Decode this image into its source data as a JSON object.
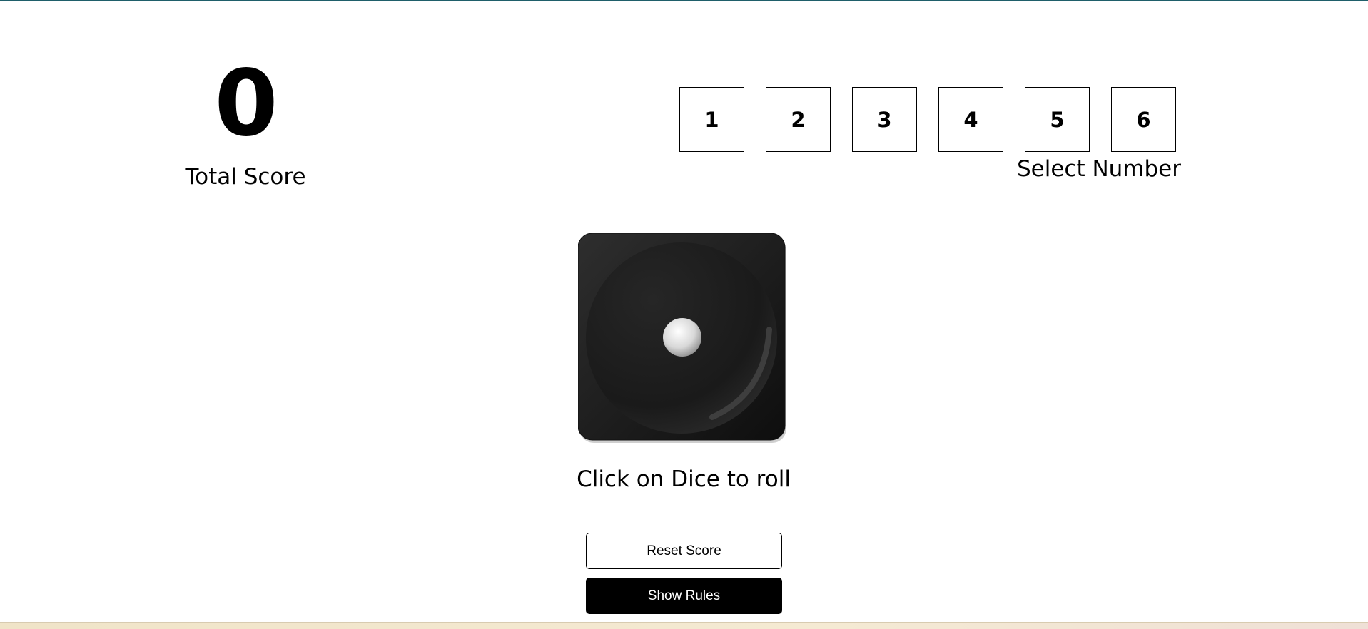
{
  "score": {
    "value": "0",
    "label": "Total Score"
  },
  "number_select": {
    "numbers": [
      "1",
      "2",
      "3",
      "4",
      "5",
      "6"
    ],
    "label": "Select Number"
  },
  "dice": {
    "face": 1,
    "icon": "dice-one-icon",
    "caption": "Click on Dice to roll"
  },
  "buttons": {
    "reset_label": "Reset Score",
    "rules_label": "Show Rules"
  },
  "colors": {
    "accent_line": "#1f5f6a",
    "dice_body": "#1c1c1c",
    "button_primary": "#000000"
  }
}
